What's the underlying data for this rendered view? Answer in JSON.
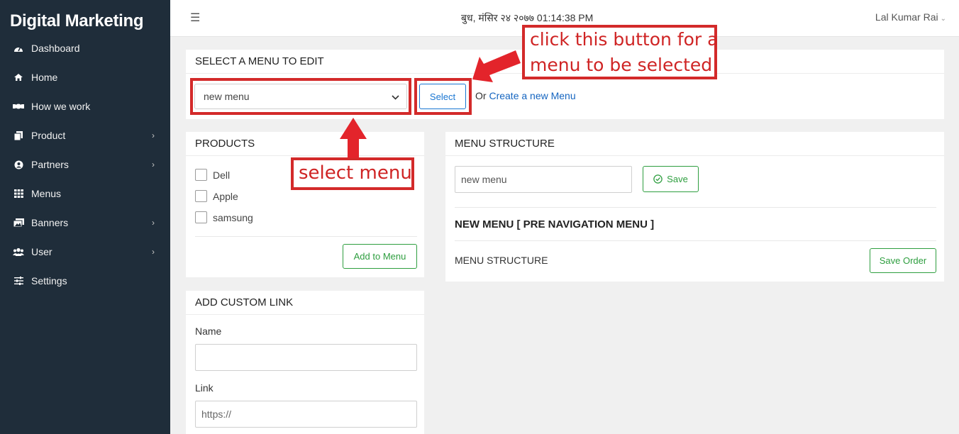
{
  "app": {
    "brand": "Digital Marketing"
  },
  "sidebar": {
    "items": [
      {
        "label": "Dashboard",
        "icon": "dashboard-icon",
        "has_children": false
      },
      {
        "label": "Home",
        "icon": "home-icon",
        "has_children": false
      },
      {
        "label": "How we work",
        "icon": "handshake-icon",
        "has_children": false
      },
      {
        "label": "Product",
        "icon": "product-icon",
        "has_children": true
      },
      {
        "label": "Partners",
        "icon": "partners-icon",
        "has_children": true
      },
      {
        "label": "Menus",
        "icon": "grid-icon",
        "has_children": false
      },
      {
        "label": "Banners",
        "icon": "image-icon",
        "has_children": true
      },
      {
        "label": "User",
        "icon": "users-icon",
        "has_children": true
      },
      {
        "label": "Settings",
        "icon": "sliders-icon",
        "has_children": false
      }
    ]
  },
  "topbar": {
    "datetime": "बुध, मंसिर २४ २०७७ 01:14:38 PM",
    "user": "Lal Kumar Rai"
  },
  "select_menu": {
    "title": "SELECT A MENU TO EDIT",
    "selected_value": "new menu",
    "select_button": "Select",
    "or_text": "Or",
    "create_link": "Create a new Menu"
  },
  "products": {
    "title": "PRODUCTS",
    "items": [
      "Dell",
      "Apple",
      "samsung"
    ],
    "add_button": "Add to Menu"
  },
  "custom_link": {
    "title": "ADD CUSTOM LINK",
    "name_label": "Name",
    "name_value": "",
    "link_label": "Link",
    "link_placeholder": "https://"
  },
  "menu_structure": {
    "title": "MENU STRUCTURE",
    "name_value": "new menu",
    "save_button": "Save",
    "subheading": "NEW MENU [ PRE NAVIGATION MENU ]",
    "structure_label": "MENU STRUCTURE",
    "save_order_button": "Save Order"
  },
  "annotations": {
    "button_note_line1": "click this button for a",
    "button_note_line2": "menu to be selected",
    "select_note": "select menu",
    "color": "#d32a2a"
  }
}
